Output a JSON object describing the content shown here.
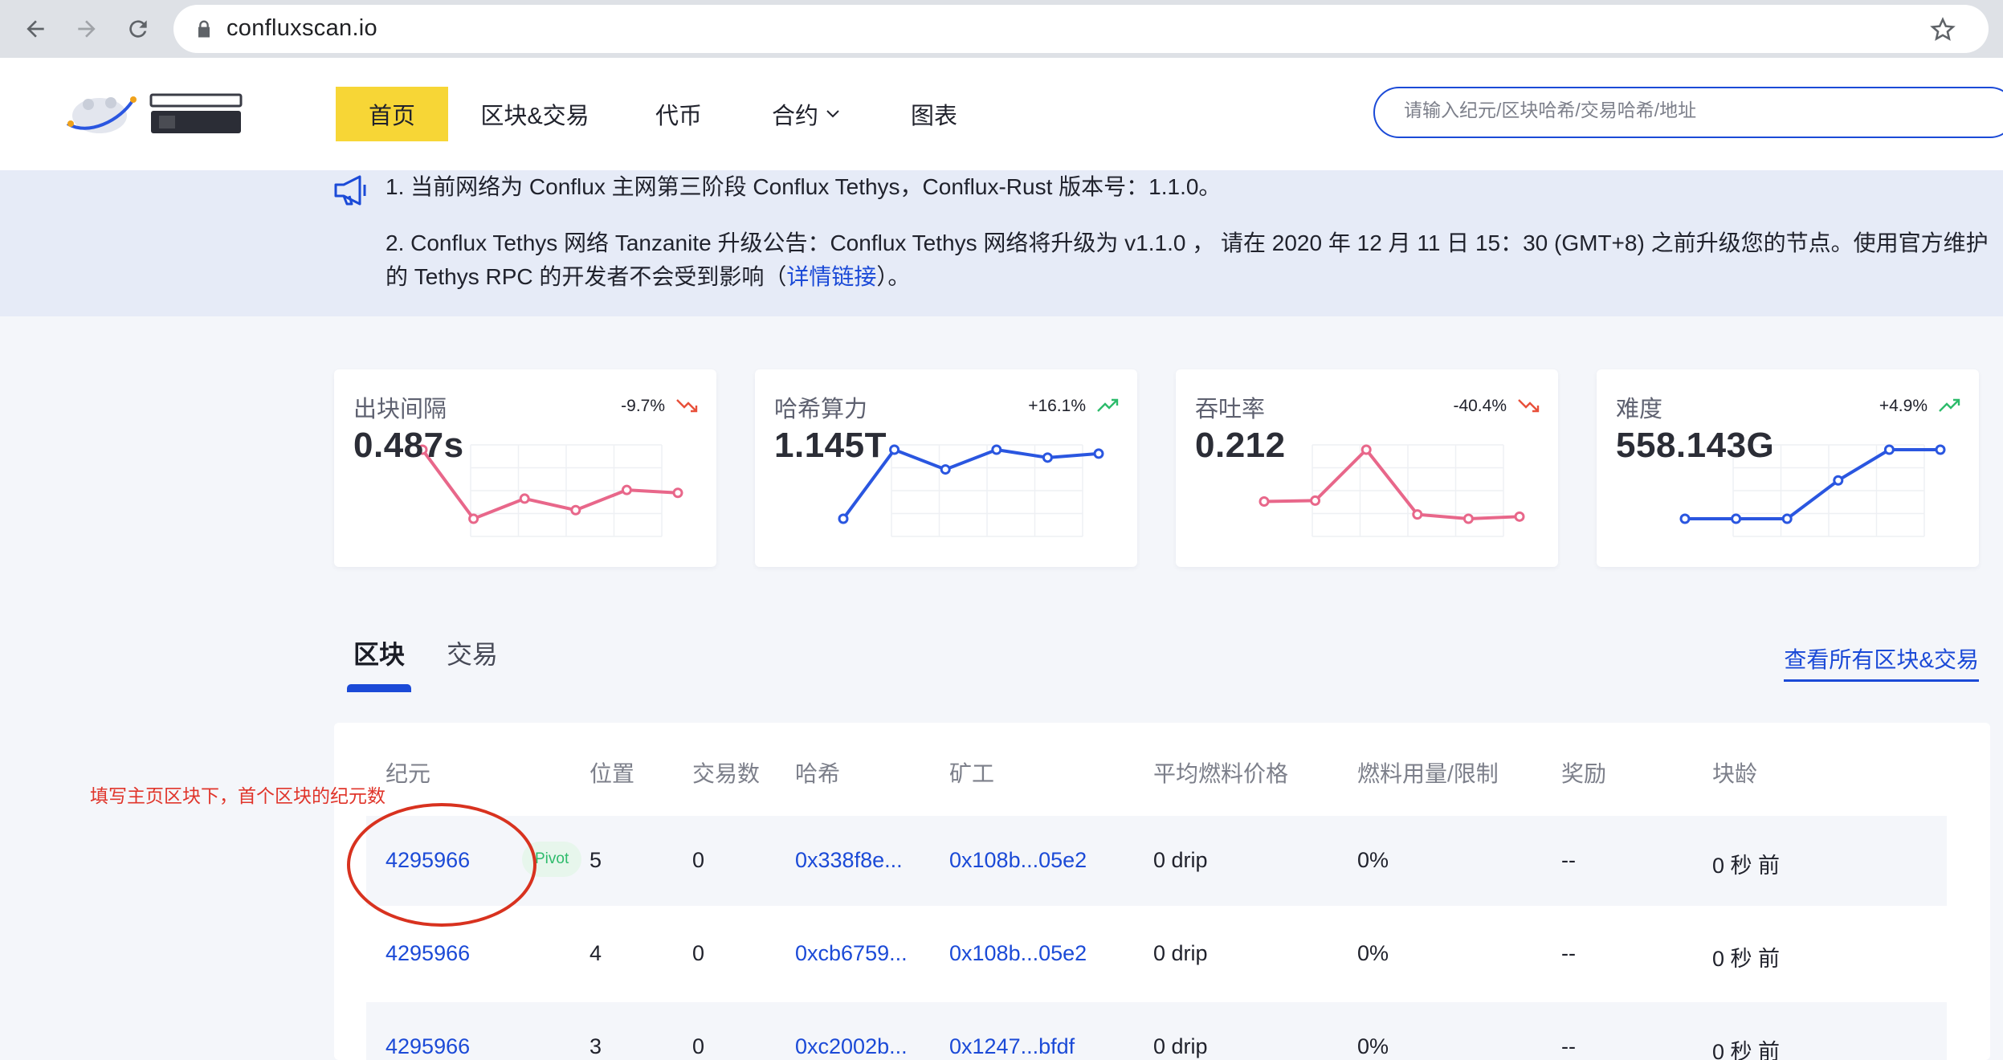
{
  "browser": {
    "url": "confluxscan.io"
  },
  "header": {
    "menu": [
      {
        "label": "首页"
      },
      {
        "label": "区块&交易"
      },
      {
        "label": "代币"
      },
      {
        "label": "合约"
      },
      {
        "label": "图表"
      }
    ],
    "search_placeholder": "请输入纪元/区块哈希/交易哈希/地址"
  },
  "notice": {
    "line1": "1. 当前网络为 Conflux 主网第三阶段 Conflux Tethys，Conflux-Rust 版本号：1.1.0。",
    "line2": "2. Conflux Tethys 网络 Tanzanite 升级公告：Conflux Tethys 网络将升级为 v1.1.0 ，  请在 2020 年 12 月 11 日 15：30 (GMT+8) 之前升级您的节点。使用官方维护",
    "line3_pre": "的 Tethys RPC 的开发者不会受到影响（",
    "line3_link": "详情链接",
    "line3_post": "）。"
  },
  "stats": [
    {
      "label": "出块间隔",
      "value": "0.487s",
      "change": "-9.7%",
      "direction": "down",
      "color": "#e8678a",
      "series": [
        0.5,
        0.452,
        0.466,
        0.458,
        0.472,
        0.47
      ]
    },
    {
      "label": "哈希算力",
      "value": "1.145T",
      "change": "+16.1%",
      "direction": "up",
      "color": "#2a56e0",
      "series": [
        0.9,
        1.25,
        1.15,
        1.25,
        1.21,
        1.23
      ]
    },
    {
      "label": "吞吐率",
      "value": "0.212",
      "change": "-40.4%",
      "direction": "down",
      "color": "#e8678a",
      "series": [
        0.24,
        0.242,
        0.36,
        0.21,
        0.2,
        0.205
      ]
    },
    {
      "label": "难度",
      "value": "558.143G",
      "change": "+4.9%",
      "direction": "up",
      "color": "#2a56e0",
      "series": [
        530,
        530,
        530,
        550,
        566,
        566
      ]
    }
  ],
  "tabs": {
    "blocks": "区块",
    "transactions": "交易",
    "view_all": "查看所有区块&交易"
  },
  "table": {
    "headers": [
      "纪元",
      "位置",
      "交易数",
      "哈希",
      "矿工",
      "平均燃料价格",
      "燃料用量/限制",
      "奖励",
      "块龄"
    ],
    "rows": [
      {
        "epoch": "4295966",
        "pivot": "Pivot",
        "position": "5",
        "txs": "0",
        "hash": "0x338f8e...",
        "miner": "0x108b...05e2",
        "gas_price": "0 drip",
        "gas_used": "0%",
        "reward": "--",
        "age": "0 秒 前"
      },
      {
        "epoch": "4295966",
        "pivot": "",
        "position": "4",
        "txs": "0",
        "hash": "0xcb6759...",
        "miner": "0x108b...05e2",
        "gas_price": "0 drip",
        "gas_used": "0%",
        "reward": "--",
        "age": "0 秒 前"
      },
      {
        "epoch": "4295966",
        "pivot": "",
        "position": "3",
        "txs": "0",
        "hash": "0xc2002b...",
        "miner": "0x1247...bfdf",
        "gas_price": "0 drip",
        "gas_used": "0%",
        "reward": "--",
        "age": "0 秒 前"
      }
    ]
  },
  "annotation": {
    "text": "填写主页区块下，首个区块的纪元数"
  }
}
